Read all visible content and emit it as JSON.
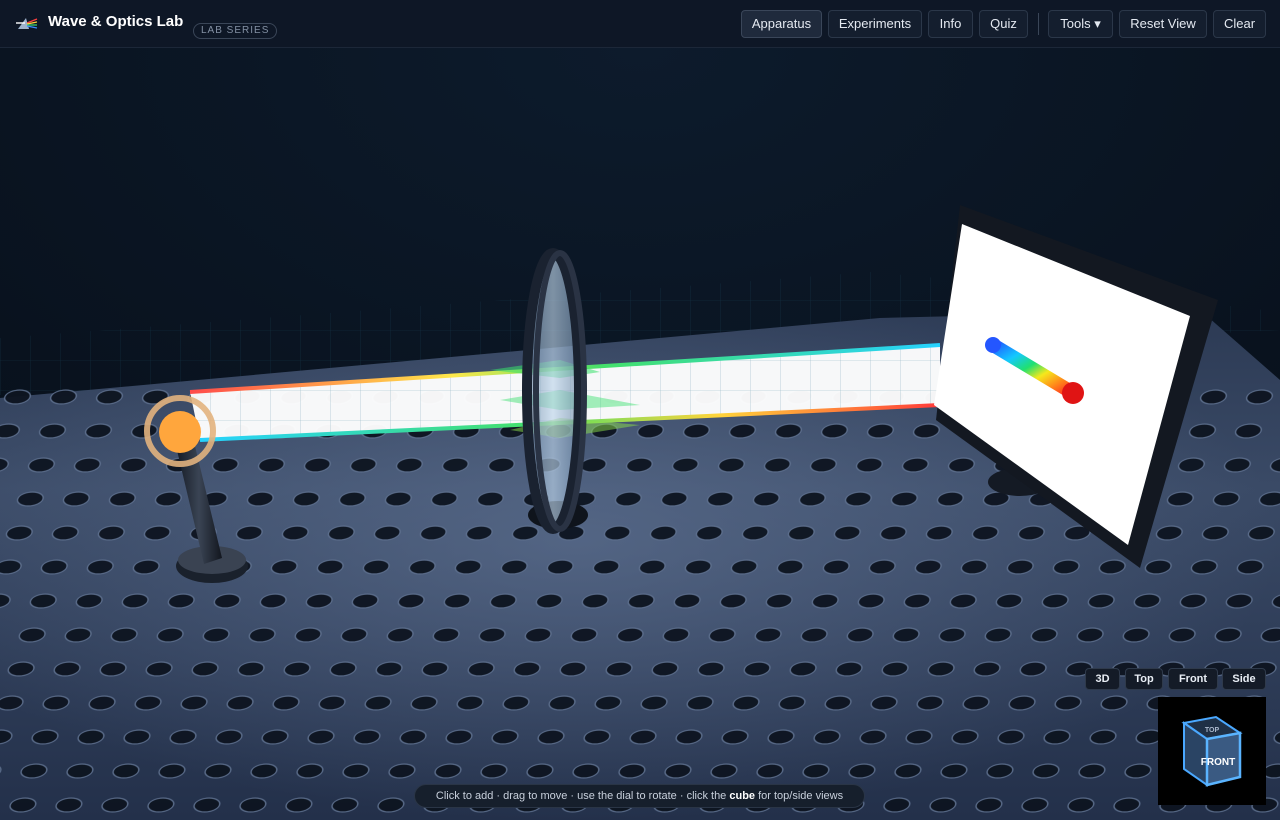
{
  "app": {
    "title": "Wave & Optics Lab",
    "badge": "LAB SERIES",
    "logo_icon": "prism-icon"
  },
  "toolbar": {
    "apparatus": "Apparatus",
    "experiments": "Experiments",
    "info": "Info",
    "quiz": "Quiz",
    "tools": "Tools ▾",
    "reset_view": "Reset View",
    "clear": "Clear",
    "active_tab": "Apparatus"
  },
  "scene": {
    "objects": [
      "light-source",
      "convex-lens",
      "projection-screen"
    ],
    "spectrum_colors": [
      "#1f5cff",
      "#14c8ff",
      "#20e070",
      "#f5e81c",
      "#ff8a1a",
      "#ff2020"
    ],
    "source_color": "#ffa63d"
  },
  "view_controls": {
    "three_d": "3D",
    "top": "Top",
    "front": "Front",
    "side": "Side"
  },
  "nav_cube": {
    "top_label": "TOP",
    "front_label": "FRONT"
  },
  "hint": {
    "before": "Click to add · drag to move · use the dial to rotate · click the ",
    "bold": "cube",
    "after": " for top/side views"
  },
  "colors": {
    "background": "#0b1422",
    "table": "#3a4a66",
    "accent": "#5ab4ff"
  }
}
